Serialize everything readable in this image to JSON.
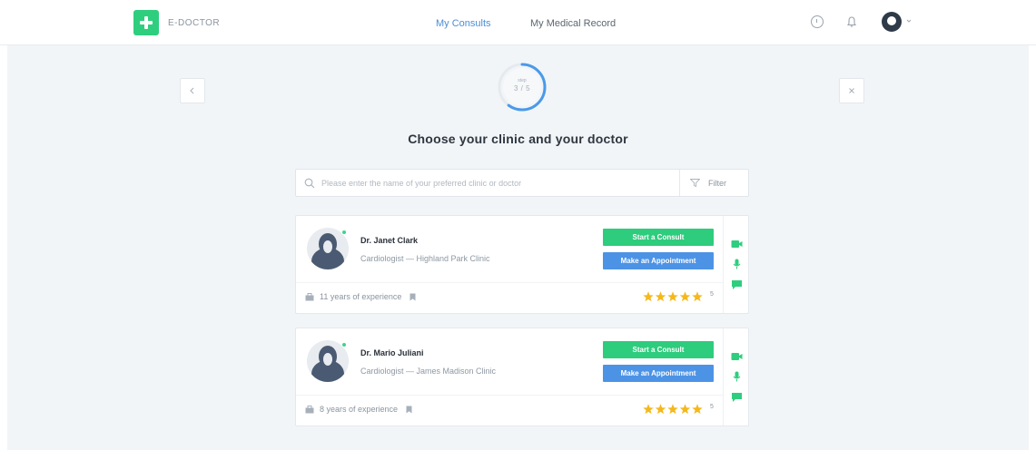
{
  "header": {
    "logo_text": "E-DOCTOR",
    "nav": [
      {
        "label": "My Consults",
        "active": true
      },
      {
        "label": "My Medical Record",
        "active": false
      }
    ],
    "icons": [
      "info-icon",
      "bell-icon",
      "avatar",
      "chevron-down-icon"
    ]
  },
  "step": {
    "label": "step",
    "count": "3 / 5",
    "progress": 0.6
  },
  "page_title": "Choose your clinic and your doctor",
  "search": {
    "placeholder": "Please enter the name of your preferred clinic or doctor",
    "value": "",
    "filter_label": "Filter"
  },
  "doctors": [
    {
      "name": "Dr. Janet Clark",
      "specialty": "Cardiologist — Highland Park Clinic",
      "experience": "11 years of experience",
      "rating": "5",
      "stars": 5,
      "consult_label": "Start a Consult",
      "appointment_label": "Make an Appointment"
    },
    {
      "name": "Dr. Mario Juliani",
      "specialty": "Cardiologist — James Madison Clinic",
      "experience": "8 years of experience",
      "rating": "5",
      "stars": 5,
      "consult_label": "Start a Consult",
      "appointment_label": "Make an Appointment"
    }
  ],
  "colors": {
    "brand_green": "#2fce7e",
    "accent_blue": "#4c93e6",
    "star_yellow": "#f5b81c",
    "background": "#f2f5f8"
  }
}
